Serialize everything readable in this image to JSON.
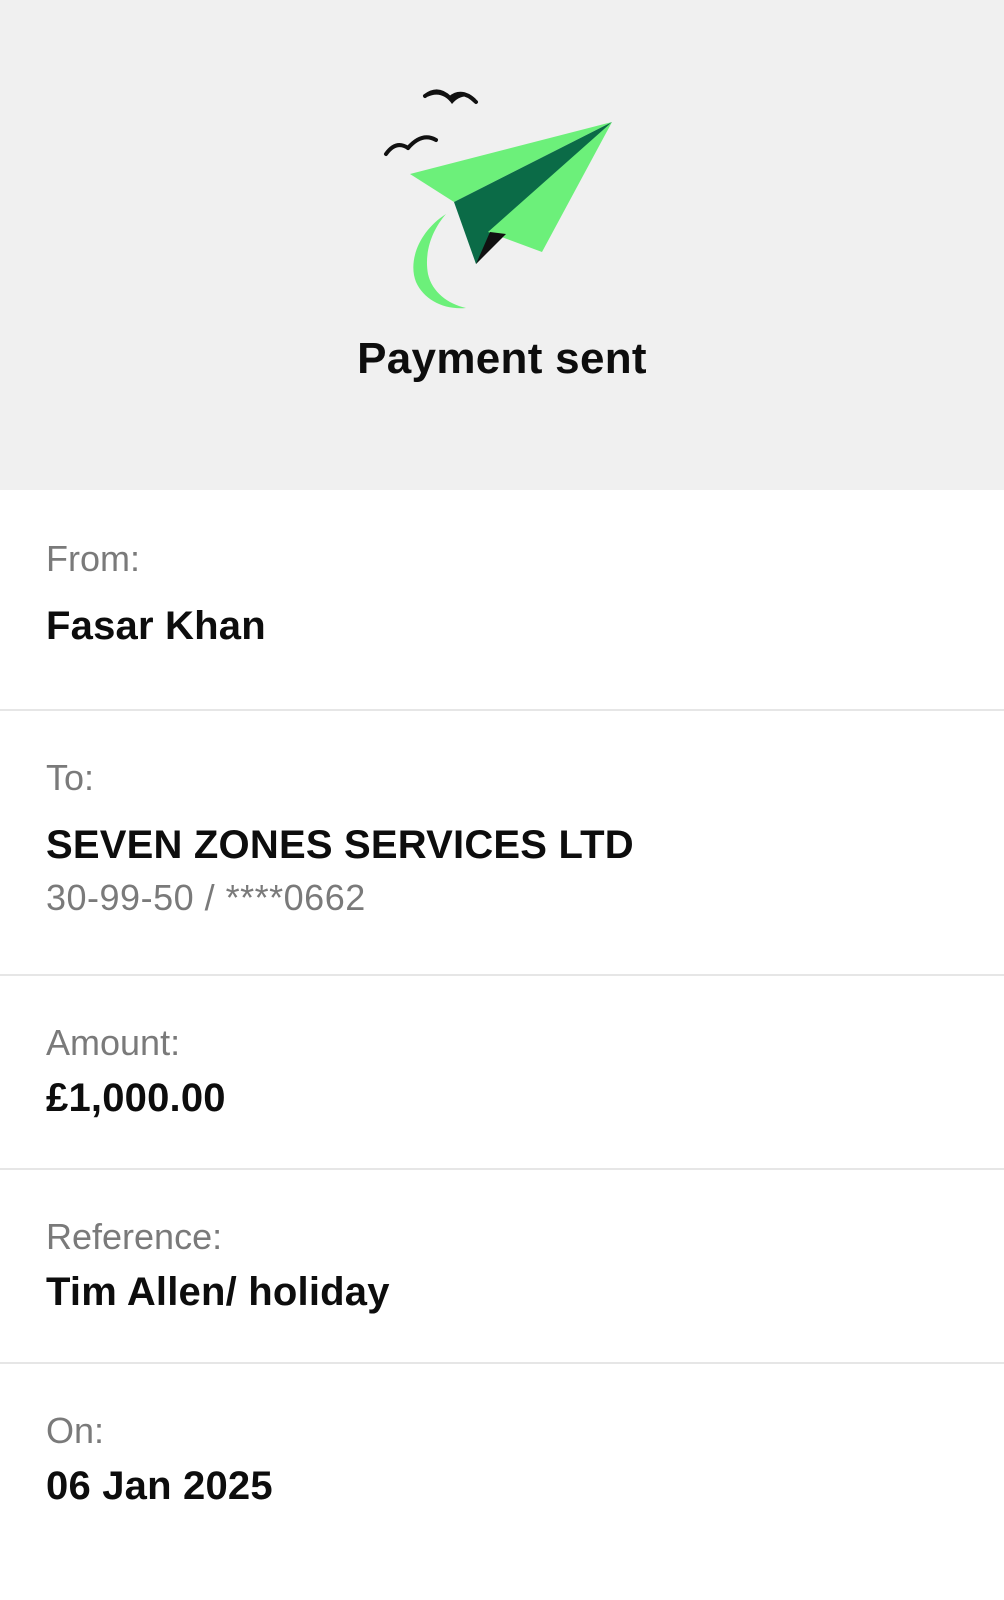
{
  "header": {
    "illustration_icon": "paper-plane-with-birds-icon",
    "title": "Payment sent",
    "colors": {
      "background": "#f0f0f0",
      "plane_light_green": "#6cf07a",
      "plane_dark_green": "#0b6b47"
    }
  },
  "details": {
    "from": {
      "label": "From:",
      "value": "Fasar Khan"
    },
    "to": {
      "label": "To:",
      "value": "SEVEN ZONES SERVICES LTD",
      "account": "30-99-50 / ****0662"
    },
    "amount": {
      "label": "Amount:",
      "value": "£1,000.00"
    },
    "reference": {
      "label": "Reference:",
      "value": "Tim Allen/ holiday"
    },
    "on": {
      "label": "On:",
      "value": "06 Jan 2025"
    }
  }
}
